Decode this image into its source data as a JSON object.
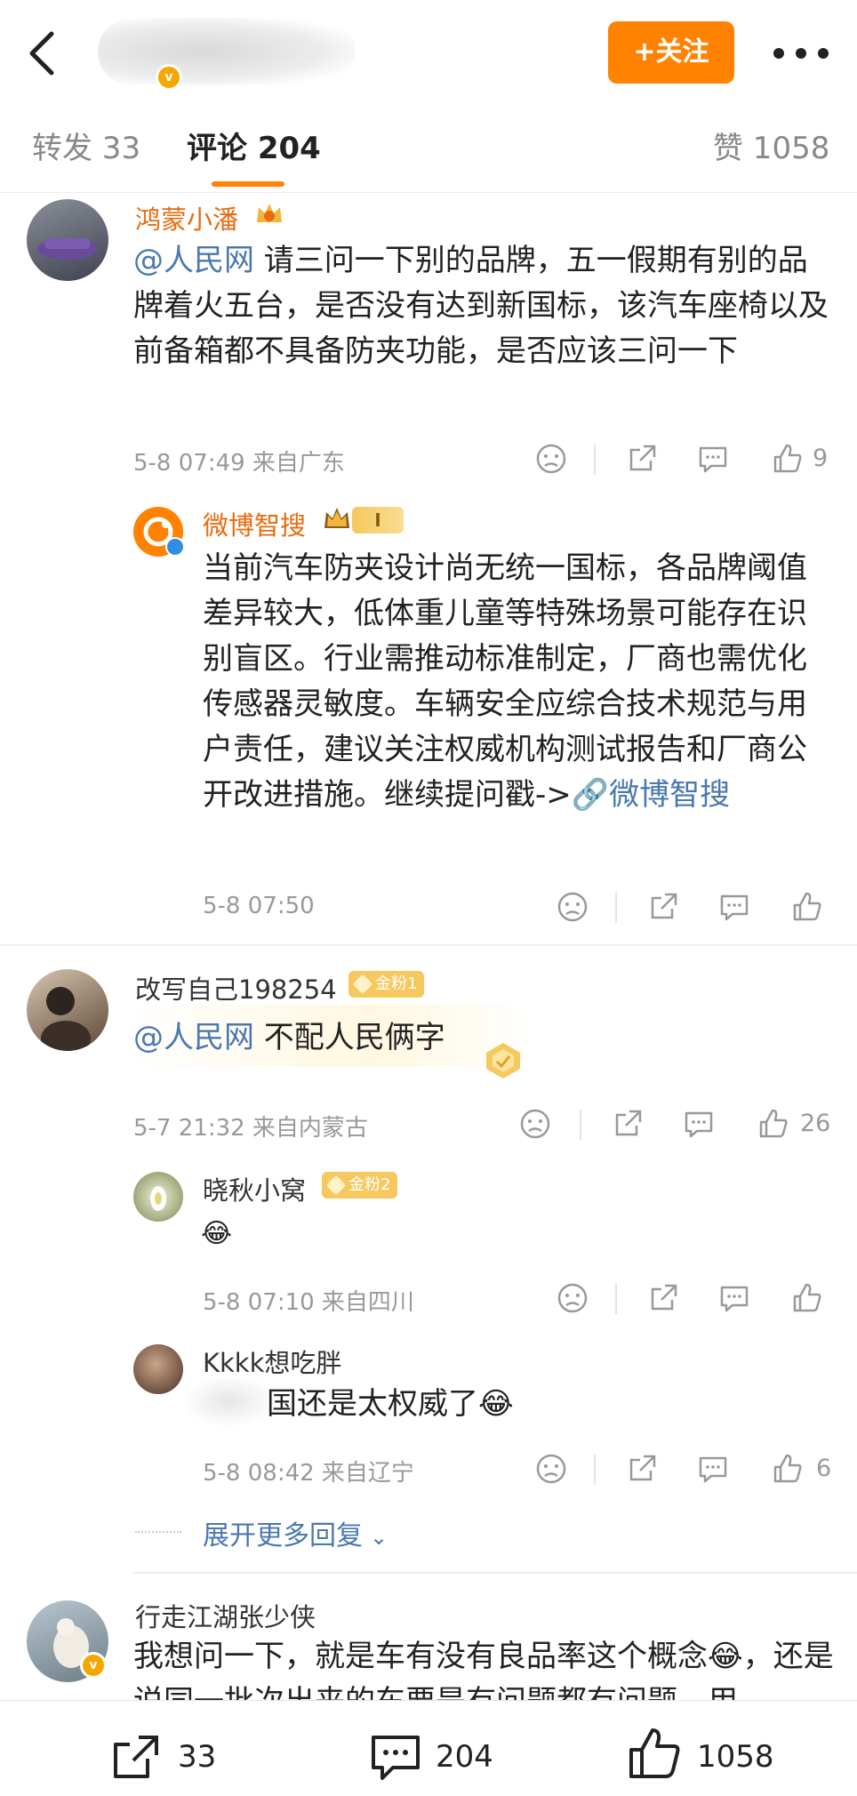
{
  "header": {
    "follow_label": "+关注",
    "verified_badge": "v"
  },
  "tabs": {
    "repost": "转发 33",
    "comments": "评论 204",
    "likes": "赞 1058"
  },
  "comments": [
    {
      "name": "鸿蒙小潘",
      "mention": "@人民网",
      "text": " 请三问一下别的品牌，五一假期有别的品牌着火五台，是否没有达到新国标，该汽车座椅以及前备箱都不具备防夹功能，是否应该三问一下",
      "meta": "5-8 07:49  来自广东",
      "likes": "9",
      "reply": {
        "name": "微博智搜",
        "level": "I",
        "text": "当前汽车防夹设计尚无统一国标，各品牌阈值差异较大，低体重儿童等特殊场景可能存在识别盲区。行业需推动标准制定，厂商也需优化传感器灵敏度。车辆安全应综合技术规范与用户责任，建议关注权威机构测试报告和厂商公开改进措施。继续提问戳->",
        "link_text": "微博智搜",
        "meta": "5-8 07:50"
      }
    },
    {
      "name": "改写自己198254",
      "badge": "金粉1",
      "mention": "@人民网",
      "text": " 不配人民俩字",
      "meta": "5-7 21:32  来自内蒙古",
      "likes": "26",
      "replies": [
        {
          "name": "晓秋小窝",
          "badge": "金粉2",
          "text": "😂",
          "meta": "5-8 07:10  来自四川"
        },
        {
          "name": "Kkkk想吃胖",
          "text": "国还是太权威了😂",
          "meta": "5-8 08:42  来自辽宁",
          "likes": "6"
        }
      ],
      "expand_label": "展开更多回复"
    },
    {
      "name": "行走江湖张少侠",
      "text": "我想问一下，就是车有没有良品率这个概念😂，还是说同一批次出来的车要是有问题都有问题，用"
    }
  ],
  "bottom_bar": {
    "repost_count": "33",
    "comment_count": "204",
    "like_count": "1058"
  },
  "colors": {
    "accent": "#ff8200",
    "link": "#4a78b0"
  }
}
